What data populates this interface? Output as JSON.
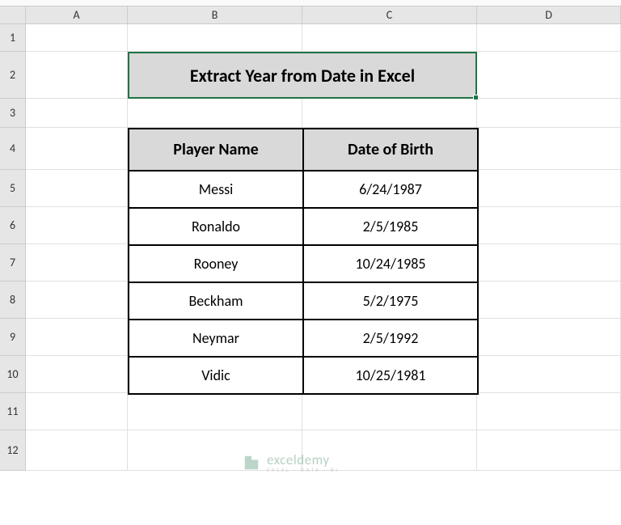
{
  "columns": [
    "A",
    "B",
    "C",
    "D"
  ],
  "rows": [
    "1",
    "2",
    "3",
    "4",
    "5",
    "6",
    "7",
    "8",
    "9",
    "10",
    "11",
    "12"
  ],
  "title": "Extract Year from Date in Excel",
  "table": {
    "headers": [
      "Player Name",
      "Date of Birth"
    ],
    "data": [
      [
        "Messi",
        "6/24/1987"
      ],
      [
        "Ronaldo",
        "2/5/1985"
      ],
      [
        "Rooney",
        "10/24/1985"
      ],
      [
        "Beckham",
        "5/2/1975"
      ],
      [
        "Neymar",
        "2/5/1992"
      ],
      [
        "Vidic",
        "10/25/1981"
      ]
    ]
  },
  "watermark": {
    "name": "exceldemy",
    "sub": "EXCEL · DATA · BI"
  },
  "chart_data": {
    "type": "table",
    "title": "Extract Year from Date in Excel",
    "columns": [
      "Player Name",
      "Date of Birth"
    ],
    "rows": [
      {
        "Player Name": "Messi",
        "Date of Birth": "6/24/1987"
      },
      {
        "Player Name": "Ronaldo",
        "Date of Birth": "2/5/1985"
      },
      {
        "Player Name": "Rooney",
        "Date of Birth": "10/24/1985"
      },
      {
        "Player Name": "Beckham",
        "Date of Birth": "5/2/1975"
      },
      {
        "Player Name": "Neymar",
        "Date of Birth": "2/5/1992"
      },
      {
        "Player Name": "Vidic",
        "Date of Birth": "10/25/1981"
      }
    ]
  }
}
